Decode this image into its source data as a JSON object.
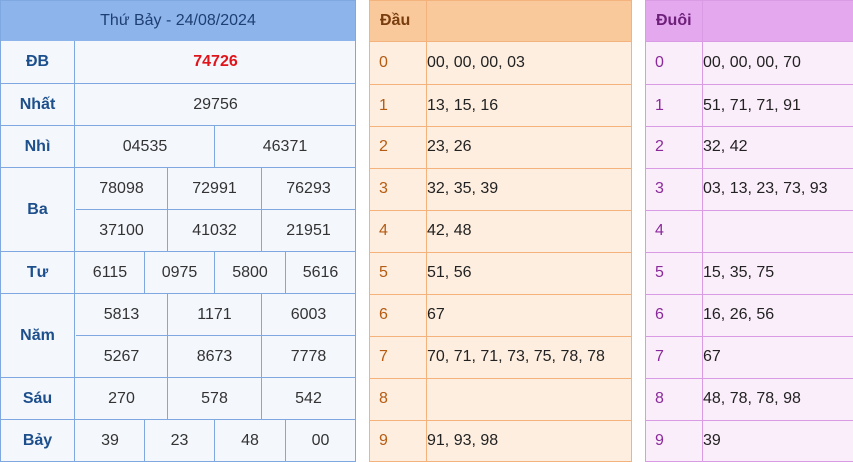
{
  "results": {
    "title": "Thứ Bảy - 24/08/2024",
    "prizes": [
      {
        "label": "ĐB",
        "rows": [
          [
            "74726"
          ]
        ]
      },
      {
        "label": "Nhất",
        "rows": [
          [
            "29756"
          ]
        ]
      },
      {
        "label": "Nhì",
        "rows": [
          [
            "04535",
            "46371"
          ]
        ]
      },
      {
        "label": "Ba",
        "rows": [
          [
            "78098",
            "72991",
            "76293"
          ],
          [
            "37100",
            "41032",
            "21951"
          ]
        ]
      },
      {
        "label": "Tư",
        "rows": [
          [
            "6115",
            "0975",
            "5800",
            "5616"
          ]
        ]
      },
      {
        "label": "Năm",
        "rows": [
          [
            "5813",
            "1171",
            "6003"
          ],
          [
            "5267",
            "8673",
            "7778"
          ]
        ]
      },
      {
        "label": "Sáu",
        "rows": [
          [
            "270",
            "578",
            "542"
          ]
        ]
      },
      {
        "label": "Bảy",
        "rows": [
          [
            "39",
            "23",
            "48",
            "00"
          ]
        ]
      }
    ],
    "special_color": "#e0141b"
  },
  "dau": {
    "header": "Đầu",
    "rows": [
      {
        "digit": "0",
        "values": "00, 00, 00, 03"
      },
      {
        "digit": "1",
        "values": "13, 15, 16"
      },
      {
        "digit": "2",
        "values": "23, 26"
      },
      {
        "digit": "3",
        "values": "32, 35, 39"
      },
      {
        "digit": "4",
        "values": "42, 48"
      },
      {
        "digit": "5",
        "values": "51, 56"
      },
      {
        "digit": "6",
        "values": "67"
      },
      {
        "digit": "7",
        "values": "70, 71, 71, 73, 75, 78, 78"
      },
      {
        "digit": "8",
        "values": ""
      },
      {
        "digit": "9",
        "values": "91, 93, 98"
      }
    ]
  },
  "duoi": {
    "header": "Đuôi",
    "rows": [
      {
        "digit": "0",
        "values": "00, 00, 00, 70"
      },
      {
        "digit": "1",
        "values": "51, 71, 71, 91"
      },
      {
        "digit": "2",
        "values": "32, 42"
      },
      {
        "digit": "3",
        "values": "03, 13, 23, 73, 93"
      },
      {
        "digit": "4",
        "values": ""
      },
      {
        "digit": "5",
        "values": "15, 35, 75"
      },
      {
        "digit": "6",
        "values": "16, 26, 56"
      },
      {
        "digit": "7",
        "values": "67"
      },
      {
        "digit": "8",
        "values": "48, 78, 78, 98"
      },
      {
        "digit": "9",
        "values": "39"
      }
    ]
  }
}
